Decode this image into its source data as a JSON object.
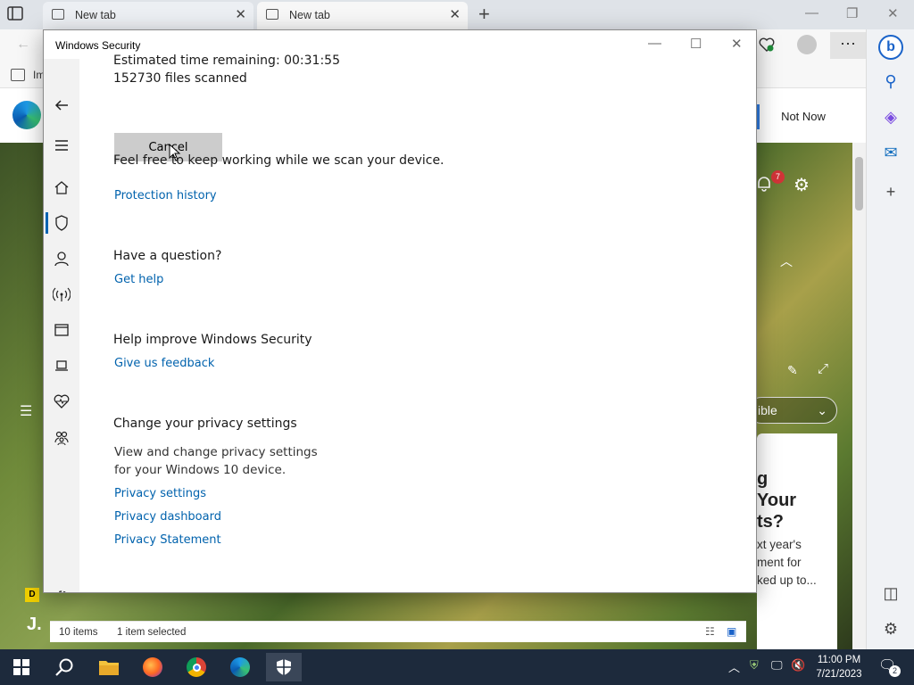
{
  "browser": {
    "tabs": [
      {
        "label": "New tab"
      },
      {
        "label": "New tab"
      }
    ],
    "favorites_text": "Im",
    "not_now_label": "Not Now",
    "notification_count": "7",
    "dropdown_text": "ible",
    "card_heading": [
      "g",
      "Your",
      "ts?"
    ],
    "card_body": [
      "xt year's",
      "ment for",
      "ked up to..."
    ],
    "left_letter": "J."
  },
  "dialog": {
    "title": "Windows Security",
    "time_remaining": "Estimated time remaining: 00:31:55",
    "files_scanned": "152730  files scanned",
    "cancel_label": "Cancel",
    "keep_working": "Feel free to keep working while we scan your device.",
    "protection_history_link": "Protection history",
    "question_heading": "Have a question?",
    "get_help_link": "Get help",
    "improve_heading": "Help improve Windows Security",
    "feedback_link": "Give us feedback",
    "privacy_heading": "Change your privacy settings",
    "privacy_desc_1": "View and change privacy settings",
    "privacy_desc_2": "for your Windows 10 device.",
    "privacy_settings_link": "Privacy settings",
    "privacy_dashboard_link": "Privacy dashboard",
    "privacy_statement_link": "Privacy Statement",
    "nav_icons": [
      "back-icon",
      "menu-icon",
      "home-icon",
      "shield-icon",
      "account-icon",
      "wireless-icon",
      "app-browser-icon",
      "laptop-icon",
      "health-icon",
      "family-icon",
      "settings-icon"
    ]
  },
  "explorer": {
    "items_count": "10 items",
    "selected": "1 item selected"
  },
  "taskbar": {
    "time": "11:00 PM",
    "date": "7/21/2023",
    "notification_badge": "2"
  },
  "colors": {
    "link": "#0062ad",
    "taskbar": "#1d2a3c",
    "nav_bg": "#f2f2f2"
  }
}
